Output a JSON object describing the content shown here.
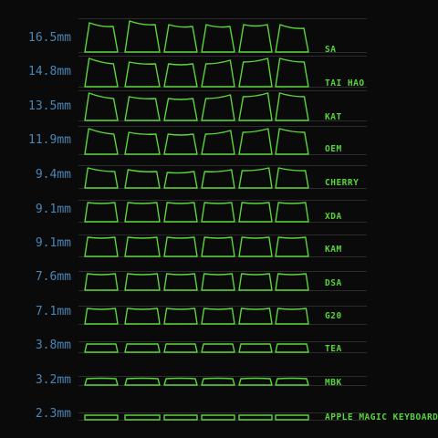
{
  "rows": [
    {
      "height": "16.5mm",
      "profile": "SA"
    },
    {
      "height": "14.8mm",
      "profile": "TAI HAO"
    },
    {
      "height": "13.5mm",
      "profile": "KAT"
    },
    {
      "height": "11.9mm",
      "profile": "OEM"
    },
    {
      "height": "9.4mm",
      "profile": "CHERRY"
    },
    {
      "height": "9.1mm",
      "profile": "XDA"
    },
    {
      "height": "9.1mm",
      "profile": "KAM"
    },
    {
      "height": "7.6mm",
      "profile": "DSA"
    },
    {
      "height": "7.1mm",
      "profile": "G20"
    },
    {
      "height": "3.8mm",
      "profile": "TEA"
    },
    {
      "height": "3.2mm",
      "profile": "MBK"
    },
    {
      "height": "2.3mm",
      "profile": "APPLE MAGIC KEYBOARD"
    }
  ],
  "colors": {
    "keycap": "#5ad63a",
    "height_label": "#4a86b5",
    "profile_label": "#58d43a",
    "background": "#0a0a0a"
  }
}
